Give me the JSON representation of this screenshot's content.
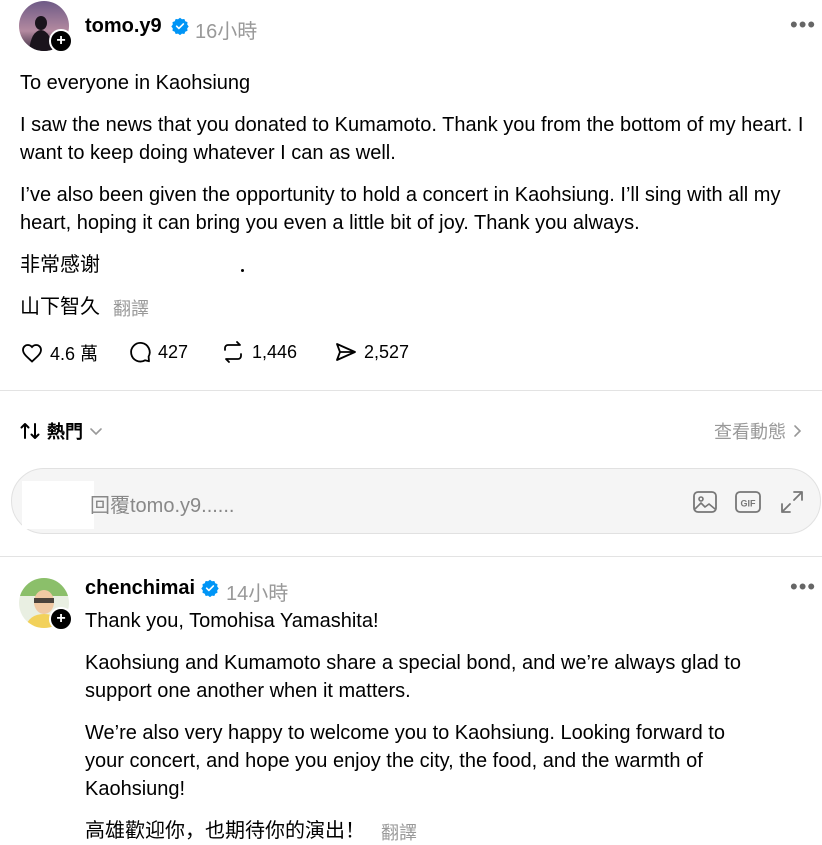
{
  "post": {
    "username": "tomo.y9",
    "time": "16小時",
    "paragraphs": [
      "To everyone in Kaohsiung",
      "I saw the news that you donated to Kumamoto. Thank you from the bottom of my heart. I want to keep doing whatever I can as well.",
      "I’ve also been given the opportunity to hold a concert in Kaohsiung. I’ll sing with all my heart, hoping it can bring you even a little bit of joy. Thank you always.",
      "非常感谢",
      "山下智久"
    ],
    "translate": "翻譯",
    "stats": {
      "likes": "4.6 萬",
      "comments": "427",
      "reposts": "1,446",
      "shares": "2,527"
    }
  },
  "replies_bar": {
    "sort_label": "熱門",
    "view_activity": "查看動態"
  },
  "reply_input": {
    "placeholder": "回覆tomo.y9......"
  },
  "comment": {
    "username": "chenchimai",
    "time": "14小時",
    "paragraphs": [
      "Thank you, Tomohisa Yamashita!",
      "Kaohsiung and Kumamoto share a special bond, and we’re always glad to support one another when it matters.",
      "We’re also very happy to welcome you to Kaohsiung. Looking forward to your concert, and hope you enjoy the city, the food, and the warmth of Kaohsiung!",
      "高雄歡迎你，也期待你的演出！"
    ],
    "translate": "翻譯"
  },
  "colors": {
    "verified": "#0095f6",
    "muted": "#999999",
    "divider": "#e3e3e3"
  }
}
